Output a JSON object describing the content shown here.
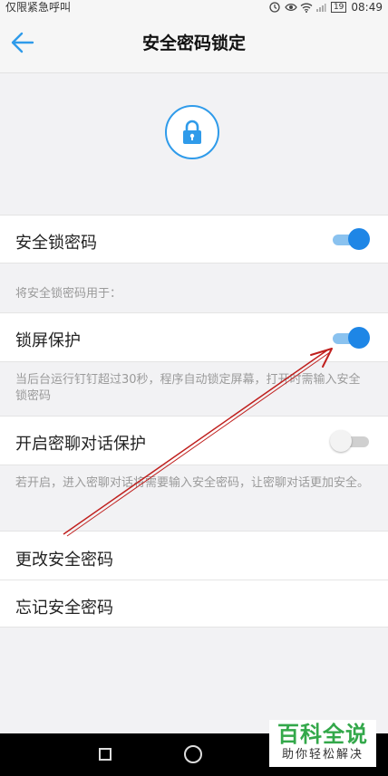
{
  "status_bar": {
    "carrier": "仅限紧急呼叫",
    "battery": "19",
    "time": "08:49",
    "icons": [
      "alarm-icon",
      "eye-icon",
      "wifi-icon",
      "signal-icon",
      "battery-icon"
    ]
  },
  "header": {
    "title": "安全密码锁定",
    "back_icon": "back-arrow-icon"
  },
  "lock_icon": "padlock-icon",
  "settings": {
    "security_password": {
      "label": "安全锁密码",
      "enabled": true
    },
    "section_caption": "将安全锁密码用于：",
    "lock_screen": {
      "label": "锁屏保护",
      "enabled": true
    },
    "lock_screen_desc": "当后台运行钉钉超过30秒，程序自动锁定屏幕，打开时需输入安全锁密码",
    "secret_chat": {
      "label": "开启密聊对话保护",
      "enabled": false
    },
    "secret_chat_desc": "若开启，进入密聊对话将需要输入安全密码，让密聊对话更加安全。",
    "change_password": "更改安全密码",
    "forgot_password": "忘记安全密码"
  },
  "colors": {
    "accent": "#1e86e6",
    "toggle_track_on": "#8ac2ef",
    "annotation": "#c0201e",
    "watermark_green": "#33a84a"
  },
  "watermark": {
    "main": "百科全说",
    "sub": "助你轻松解决"
  }
}
